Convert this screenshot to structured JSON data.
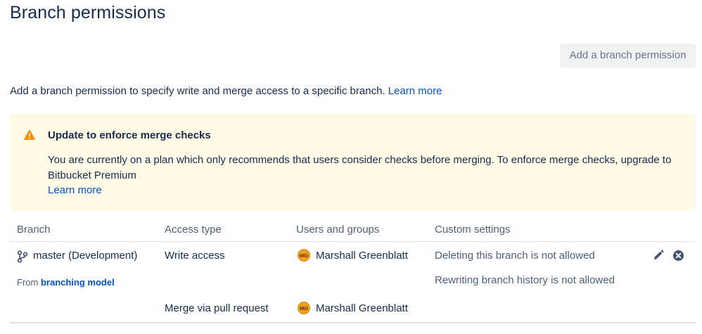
{
  "page": {
    "title": "Branch permissions",
    "add_button_label": "Add a branch permission",
    "intro_text": "Add a branch permission to specify write and merge access to a specific branch.",
    "intro_link": "Learn more"
  },
  "warning": {
    "icon": "warning-icon",
    "title": "Update to enforce merge checks",
    "body": "You are currently on a plan which only recommends that users consider checks before merging. To enforce merge checks, upgrade to Bitbucket Premium",
    "link": "Learn more",
    "background": "#fffae6",
    "icon_color": "#ff8b00"
  },
  "table": {
    "headers": [
      "Branch",
      "Access type",
      "Users and groups",
      "Custom settings"
    ],
    "row": {
      "branch_icon": "branch-icon",
      "branch": "master (Development)",
      "from_prefix": "From",
      "from_link": "branching model",
      "access": [
        {
          "type": "Write access",
          "user_initials": "MG",
          "user": "Marshall Greenblatt"
        },
        {
          "type": "Merge via pull request",
          "user_initials": "MG",
          "user": "Marshall Greenblatt"
        }
      ],
      "custom_settings": [
        "Deleting this branch is not allowed",
        "Rewriting branch history is not allowed"
      ],
      "actions": [
        "edit-icon",
        "remove-icon"
      ]
    }
  },
  "colors": {
    "link": "#0052cc",
    "text": "#172b4d",
    "muted": "#505f79",
    "avatar": "#f0a01e"
  }
}
